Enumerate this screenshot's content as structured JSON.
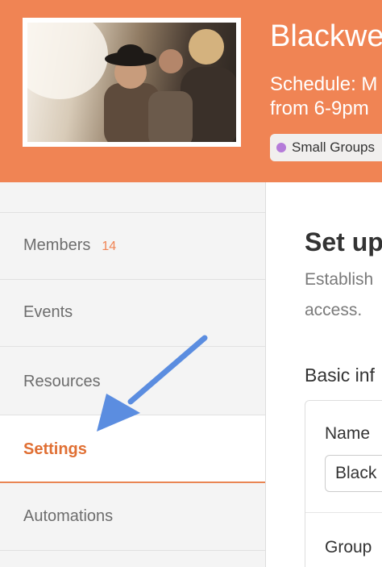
{
  "header": {
    "title": "Blackwe",
    "schedule_line1": "Schedule: M",
    "schedule_line2": "from 6-9pm",
    "tag": {
      "label": "Small Groups",
      "color": "#b57bd9"
    },
    "background_color": "#f08454"
  },
  "sidebar": {
    "items": [
      {
        "label": "Members",
        "count": "14"
      },
      {
        "label": "Events"
      },
      {
        "label": "Resources"
      },
      {
        "label": "Settings",
        "active": true
      },
      {
        "label": "Automations"
      }
    ]
  },
  "main": {
    "title": "Set up",
    "description_line1": "Establish",
    "description_line2": "access.",
    "section_heading": "Basic inf",
    "fields": {
      "name_label": "Name",
      "name_value": "Black",
      "group_label": "Group"
    }
  },
  "annotation": {
    "arrow_color": "#5b8de0"
  }
}
